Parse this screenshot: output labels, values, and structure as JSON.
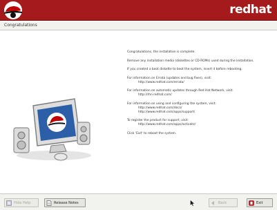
{
  "header": {
    "brand": "redhat"
  },
  "page": {
    "title": "Congratulations"
  },
  "message": {
    "paragraphs": [
      "Congratulations, the installation is complete.",
      "Remove any installation media (diskettes or CD-ROMs) used during the installation.",
      "If you created a boot diskette to boot the system, insert it before rebooting.",
      "For information on Errata (updates and bug fixes), visit:",
      "For information on automatic updates through Red Hat Network, visit:",
      "For information on using and configuring the system, visit:",
      "To register the product for support, visit:",
      "Click 'Exit' to reboot the system."
    ],
    "links": {
      "errata": "http://www.redhat.com/errata/",
      "rhn": "http://rhn.redhat.com/",
      "docs_1": "http://www.redhat.com/docs/",
      "docs_2": "http://www.redhat.com/apps/support/",
      "register": "http://www.redhat.com/apps/activate/"
    }
  },
  "buttons": {
    "hide_help": "Hide Help",
    "release_notes": "Release Notes",
    "back": "Back",
    "exit": "Exit"
  },
  "colors": {
    "header_red": "#a51a1a",
    "panel": "#f2f2ee"
  },
  "icons": {
    "logo": "shadowman-logo",
    "illustration": "computer-with-redhat-screen"
  }
}
